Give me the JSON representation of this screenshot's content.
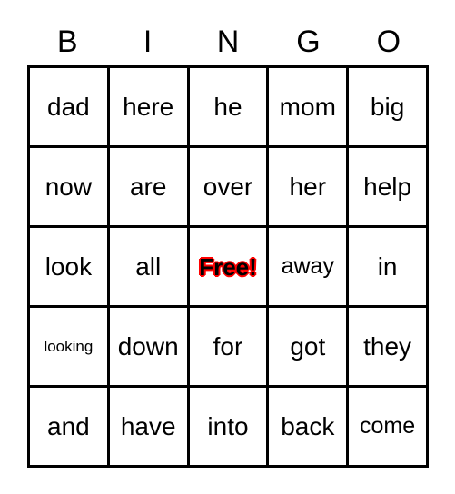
{
  "card": {
    "title": "BINGO",
    "free_space_label": "Free!",
    "free_space_color": "#ff0000",
    "border_color": "#000000",
    "background_color": "#ffffff",
    "columns": 5,
    "rows": 5
  },
  "header": {
    "letters": [
      "B",
      "I",
      "N",
      "G",
      "O"
    ]
  },
  "grid": {
    "rows": [
      {
        "cells": [
          {
            "text": "dad",
            "free": false,
            "size": "normal"
          },
          {
            "text": "here",
            "free": false,
            "size": "normal"
          },
          {
            "text": "he",
            "free": false,
            "size": "normal"
          },
          {
            "text": "mom",
            "free": false,
            "size": "normal"
          },
          {
            "text": "big",
            "free": false,
            "size": "normal"
          }
        ]
      },
      {
        "cells": [
          {
            "text": "now",
            "free": false,
            "size": "normal"
          },
          {
            "text": "are",
            "free": false,
            "size": "normal"
          },
          {
            "text": "over",
            "free": false,
            "size": "normal"
          },
          {
            "text": "her",
            "free": false,
            "size": "normal"
          },
          {
            "text": "help",
            "free": false,
            "size": "normal"
          }
        ]
      },
      {
        "cells": [
          {
            "text": "look",
            "free": false,
            "size": "normal"
          },
          {
            "text": "all",
            "free": false,
            "size": "normal"
          },
          {
            "text": "Free!",
            "free": true,
            "size": "normal"
          },
          {
            "text": "away",
            "free": false,
            "size": "md"
          },
          {
            "text": "in",
            "free": false,
            "size": "normal"
          }
        ]
      },
      {
        "cells": [
          {
            "text": "looking",
            "free": false,
            "size": "sm"
          },
          {
            "text": "down",
            "free": false,
            "size": "normal"
          },
          {
            "text": "for",
            "free": false,
            "size": "normal"
          },
          {
            "text": "got",
            "free": false,
            "size": "normal"
          },
          {
            "text": "they",
            "free": false,
            "size": "normal"
          }
        ]
      },
      {
        "cells": [
          {
            "text": "and",
            "free": false,
            "size": "normal"
          },
          {
            "text": "have",
            "free": false,
            "size": "normal"
          },
          {
            "text": "into",
            "free": false,
            "size": "normal"
          },
          {
            "text": "back",
            "free": false,
            "size": "normal"
          },
          {
            "text": "come",
            "free": false,
            "size": "md"
          }
        ]
      }
    ]
  }
}
